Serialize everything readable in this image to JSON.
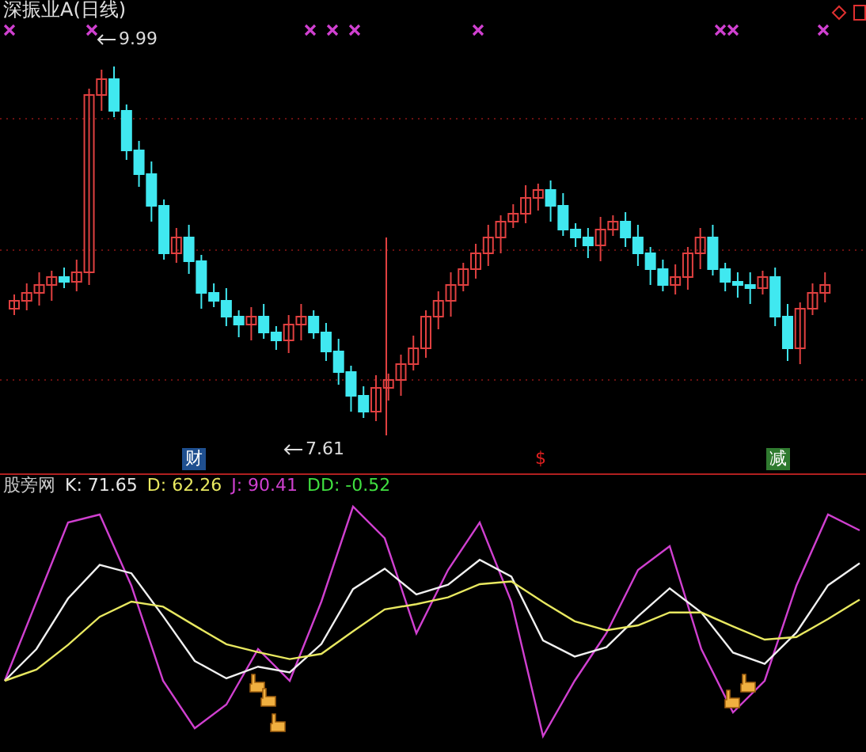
{
  "chart_title": "深振业A(日线)",
  "price_labels": [
    {
      "kind": "high",
      "text": "9.99"
    },
    {
      "kind": "low",
      "text": "7.61"
    }
  ],
  "event_markers": [
    {
      "text": "财",
      "color": "#1f4f8f"
    },
    {
      "text": "$",
      "color": "#e02020"
    },
    {
      "text": "减",
      "color": "#2f7a2f"
    }
  ],
  "indicator": {
    "name": "股旁网",
    "values": [
      {
        "text": "K: 71.65",
        "color": "#e8e8e8"
      },
      {
        "text": "D: 62.26",
        "color": "#e8e860"
      },
      {
        "text": "J: 90.41",
        "color": "#d040d0"
      },
      {
        "text": "DD: -0.52",
        "color": "#40e040"
      }
    ]
  }
}
